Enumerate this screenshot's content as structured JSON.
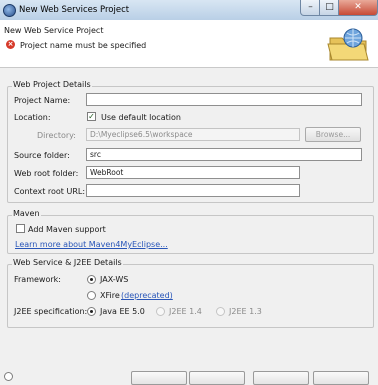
{
  "window": {
    "title": "New Web Services Project",
    "minimize_glyph": "–",
    "maximize_glyph": "□",
    "close_glyph": "✕"
  },
  "header": {
    "title": "New Web Service Project",
    "error_message": "Project name must be specified",
    "error_icon": "error-icon",
    "wizard_icon": "folder-globe-wizard-icon"
  },
  "web_project_details": {
    "group_title": "Web Project Details",
    "project_name_label": "Project Name:",
    "project_name_value": "",
    "location_label": "Location:",
    "use_default_location_label": "Use default location",
    "use_default_location_checked": true,
    "directory_label": "Directory:",
    "directory_value": "D:\\Myeclipse6.5\\workspace",
    "browse_label": "Browse...",
    "source_folder_label": "Source folder:",
    "source_folder_value": "src",
    "web_root_folder_label": "Web root folder:",
    "web_root_folder_value": "WebRoot",
    "context_root_url_label": "Context root URL:",
    "context_root_url_value": ""
  },
  "maven": {
    "group_title": "Maven",
    "add_maven_support_label": "Add Maven support",
    "add_maven_support_checked": false,
    "learn_more_link": "Learn more about Maven4MyEclipse..."
  },
  "web_service_details": {
    "group_title": "Web Service & J2EE Details",
    "framework_label": "Framework:",
    "framework_options": [
      {
        "label": "JAX-WS",
        "checked": true
      },
      {
        "label": "XFire",
        "checked": false,
        "note": "(deprecated)"
      }
    ],
    "j2ee_spec_label": "J2EE specification:",
    "j2ee_options": [
      {
        "label": "Java EE 5.0",
        "checked": true,
        "enabled": true
      },
      {
        "label": "J2EE 1.4",
        "checked": false,
        "enabled": false
      },
      {
        "label": "J2EE 1.3",
        "checked": false,
        "enabled": false
      }
    ]
  },
  "colors": {
    "accent_link": "#2855b8",
    "error": "#d63a2a",
    "close_button": "#c74a36"
  }
}
